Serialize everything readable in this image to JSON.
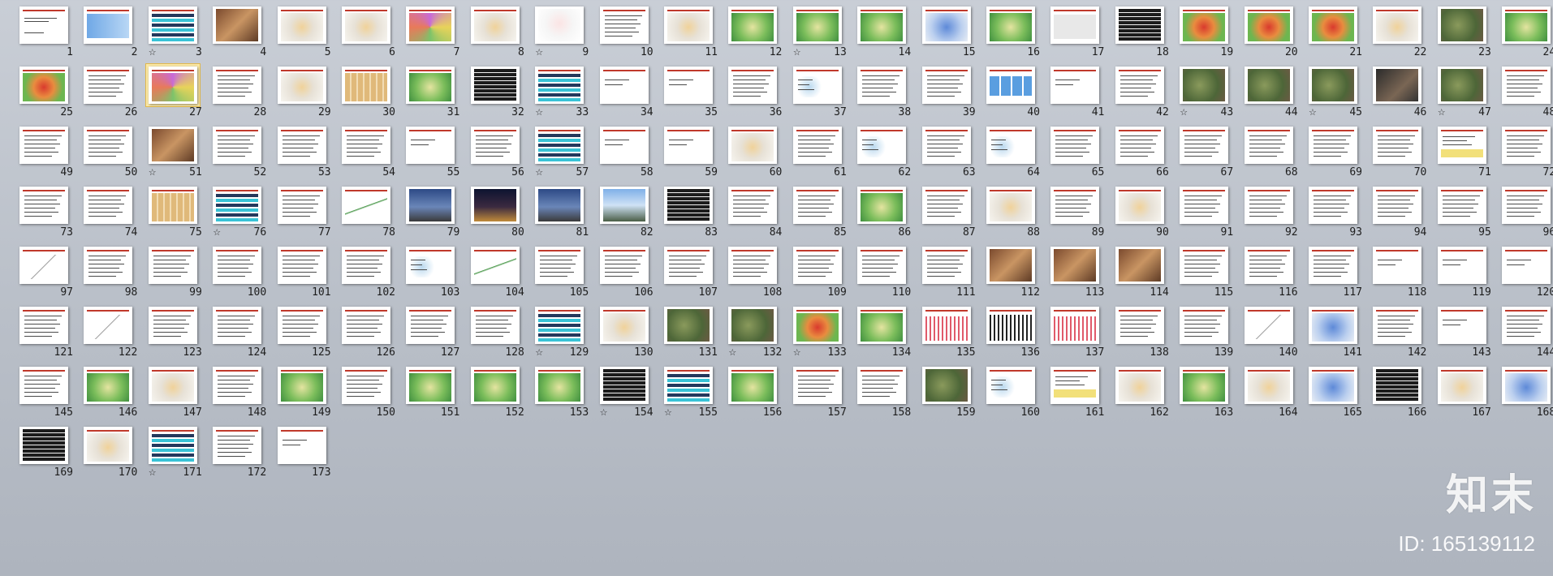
{
  "slides": [
    {
      "n": "1",
      "anim": false,
      "kind": "title"
    },
    {
      "n": "2",
      "anim": false,
      "kind": "blue"
    },
    {
      "n": "3",
      "anim": true,
      "kind": "table-cyan"
    },
    {
      "n": "4",
      "anim": false,
      "kind": "photo-brown"
    },
    {
      "n": "5",
      "anim": false,
      "kind": "map-light"
    },
    {
      "n": "6",
      "anim": false,
      "kind": "map-light"
    },
    {
      "n": "7",
      "anim": false,
      "kind": "map-color"
    },
    {
      "n": "8",
      "anim": false,
      "kind": "map-light"
    },
    {
      "n": "9",
      "anim": true,
      "kind": "cartoon"
    },
    {
      "n": "10",
      "anim": false,
      "kind": "text"
    },
    {
      "n": "11",
      "anim": false,
      "kind": "map-light"
    },
    {
      "n": "12",
      "anim": false,
      "kind": "map-green"
    },
    {
      "n": "13",
      "anim": true,
      "kind": "map-green"
    },
    {
      "n": "14",
      "anim": false,
      "kind": "map-green"
    },
    {
      "n": "15",
      "anim": false,
      "kind": "map-blue"
    },
    {
      "n": "16",
      "anim": false,
      "kind": "map-green"
    },
    {
      "n": "17",
      "anim": false,
      "kind": "text-grey"
    },
    {
      "n": "18",
      "anim": false,
      "kind": "table-dark"
    },
    {
      "n": "19",
      "anim": false,
      "kind": "map-red"
    },
    {
      "n": "20",
      "anim": false,
      "kind": "map-red"
    },
    {
      "n": "21",
      "anim": false,
      "kind": "map-red"
    },
    {
      "n": "22",
      "anim": false,
      "kind": "map-light"
    },
    {
      "n": "23",
      "anim": false,
      "kind": "photo-aerial"
    },
    {
      "n": "24",
      "anim": false,
      "kind": "map-green"
    },
    {
      "n": "25",
      "anim": false,
      "kind": "map-red"
    },
    {
      "n": "26",
      "anim": false,
      "kind": "text"
    },
    {
      "n": "27",
      "anim": false,
      "kind": "map-color",
      "selected": true
    },
    {
      "n": "28",
      "anim": false,
      "kind": "text"
    },
    {
      "n": "29",
      "anim": false,
      "kind": "map-light"
    },
    {
      "n": "30",
      "anim": false,
      "kind": "map-tan"
    },
    {
      "n": "31",
      "anim": false,
      "kind": "map-green"
    },
    {
      "n": "32",
      "anim": false,
      "kind": "table-dark"
    },
    {
      "n": "33",
      "anim": true,
      "kind": "table-cyan"
    },
    {
      "n": "34",
      "anim": false,
      "kind": "text-short"
    },
    {
      "n": "35",
      "anim": false,
      "kind": "text-short"
    },
    {
      "n": "36",
      "anim": false,
      "kind": "text"
    },
    {
      "n": "37",
      "anim": false,
      "kind": "diagram"
    },
    {
      "n": "38",
      "anim": false,
      "kind": "text"
    },
    {
      "n": "39",
      "anim": false,
      "kind": "text"
    },
    {
      "n": "40",
      "anim": false,
      "kind": "blue-blocks"
    },
    {
      "n": "41",
      "anim": false,
      "kind": "text-short"
    },
    {
      "n": "42",
      "anim": false,
      "kind": "text"
    },
    {
      "n": "43",
      "anim": true,
      "kind": "photo-aerial"
    },
    {
      "n": "44",
      "anim": false,
      "kind": "photo-aerial"
    },
    {
      "n": "45",
      "anim": true,
      "kind": "photo-aerial"
    },
    {
      "n": "46",
      "anim": false,
      "kind": "photo-dark"
    },
    {
      "n": "47",
      "anim": true,
      "kind": "photo-aerial"
    },
    {
      "n": "48",
      "anim": false,
      "kind": "text"
    },
    {
      "n": "49",
      "anim": false,
      "kind": "text"
    },
    {
      "n": "50",
      "anim": false,
      "kind": "text"
    },
    {
      "n": "51",
      "anim": true,
      "kind": "photo-brown"
    },
    {
      "n": "52",
      "anim": false,
      "kind": "text"
    },
    {
      "n": "53",
      "anim": false,
      "kind": "text"
    },
    {
      "n": "54",
      "anim": false,
      "kind": "text"
    },
    {
      "n": "55",
      "anim": false,
      "kind": "text-short"
    },
    {
      "n": "56",
      "anim": false,
      "kind": "text"
    },
    {
      "n": "57",
      "anim": true,
      "kind": "table-cyan"
    },
    {
      "n": "58",
      "anim": false,
      "kind": "text-short"
    },
    {
      "n": "59",
      "anim": false,
      "kind": "text-short"
    },
    {
      "n": "60",
      "anim": false,
      "kind": "map-light"
    },
    {
      "n": "61",
      "anim": false,
      "kind": "text"
    },
    {
      "n": "62",
      "anim": false,
      "kind": "diagram"
    },
    {
      "n": "63",
      "anim": false,
      "kind": "text"
    },
    {
      "n": "64",
      "anim": false,
      "kind": "diagram"
    },
    {
      "n": "65",
      "anim": false,
      "kind": "text"
    },
    {
      "n": "66",
      "anim": false,
      "kind": "text"
    },
    {
      "n": "67",
      "anim": false,
      "kind": "text"
    },
    {
      "n": "68",
      "anim": false,
      "kind": "text"
    },
    {
      "n": "69",
      "anim": false,
      "kind": "text"
    },
    {
      "n": "70",
      "anim": false,
      "kind": "text"
    },
    {
      "n": "71",
      "anim": false,
      "kind": "text-yellow"
    },
    {
      "n": "72",
      "anim": false,
      "kind": "text"
    },
    {
      "n": "73",
      "anim": false,
      "kind": "text"
    },
    {
      "n": "74",
      "anim": false,
      "kind": "text"
    },
    {
      "n": "75",
      "anim": false,
      "kind": "map-tan"
    },
    {
      "n": "76",
      "anim": true,
      "kind": "table-cyan"
    },
    {
      "n": "77",
      "anim": false,
      "kind": "text"
    },
    {
      "n": "78",
      "anim": false,
      "kind": "chart"
    },
    {
      "n": "79",
      "anim": false,
      "kind": "photo-city"
    },
    {
      "n": "80",
      "anim": false,
      "kind": "photo-night"
    },
    {
      "n": "81",
      "anim": false,
      "kind": "photo-city"
    },
    {
      "n": "82",
      "anim": false,
      "kind": "photo-sky"
    },
    {
      "n": "83",
      "anim": false,
      "kind": "table-dark"
    },
    {
      "n": "84",
      "anim": false,
      "kind": "text"
    },
    {
      "n": "85",
      "anim": false,
      "kind": "text"
    },
    {
      "n": "86",
      "anim": false,
      "kind": "map-green"
    },
    {
      "n": "87",
      "anim": false,
      "kind": "text"
    },
    {
      "n": "88",
      "anim": false,
      "kind": "map-light"
    },
    {
      "n": "89",
      "anim": false,
      "kind": "text"
    },
    {
      "n": "90",
      "anim": false,
      "kind": "map-light"
    },
    {
      "n": "91",
      "anim": false,
      "kind": "text"
    },
    {
      "n": "92",
      "anim": false,
      "kind": "text"
    },
    {
      "n": "93",
      "anim": false,
      "kind": "text"
    },
    {
      "n": "94",
      "anim": false,
      "kind": "text"
    },
    {
      "n": "95",
      "anim": false,
      "kind": "text"
    },
    {
      "n": "96",
      "anim": false,
      "kind": "text"
    },
    {
      "n": "97",
      "anim": false,
      "kind": "triangle"
    },
    {
      "n": "98",
      "anim": false,
      "kind": "text"
    },
    {
      "n": "99",
      "anim": false,
      "kind": "text"
    },
    {
      "n": "100",
      "anim": false,
      "kind": "text"
    },
    {
      "n": "101",
      "anim": false,
      "kind": "text"
    },
    {
      "n": "102",
      "anim": false,
      "kind": "text"
    },
    {
      "n": "103",
      "anim": false,
      "kind": "diagram"
    },
    {
      "n": "104",
      "anim": false,
      "kind": "chart"
    },
    {
      "n": "105",
      "anim": false,
      "kind": "text"
    },
    {
      "n": "106",
      "anim": false,
      "kind": "text"
    },
    {
      "n": "107",
      "anim": false,
      "kind": "text"
    },
    {
      "n": "108",
      "anim": false,
      "kind": "text"
    },
    {
      "n": "109",
      "anim": false,
      "kind": "text"
    },
    {
      "n": "110",
      "anim": false,
      "kind": "text"
    },
    {
      "n": "111",
      "anim": false,
      "kind": "text"
    },
    {
      "n": "112",
      "anim": false,
      "kind": "photo-brown"
    },
    {
      "n": "113",
      "anim": false,
      "kind": "photo-brown"
    },
    {
      "n": "114",
      "anim": false,
      "kind": "photo-brown"
    },
    {
      "n": "115",
      "anim": false,
      "kind": "text"
    },
    {
      "n": "116",
      "anim": false,
      "kind": "text"
    },
    {
      "n": "117",
      "anim": false,
      "kind": "text"
    },
    {
      "n": "118",
      "anim": false,
      "kind": "text-short"
    },
    {
      "n": "119",
      "anim": false,
      "kind": "text-short"
    },
    {
      "n": "120",
      "anim": false,
      "kind": "text-short"
    },
    {
      "n": "121",
      "anim": false,
      "kind": "text"
    },
    {
      "n": "122",
      "anim": false,
      "kind": "triangle"
    },
    {
      "n": "123",
      "anim": false,
      "kind": "text"
    },
    {
      "n": "124",
      "anim": false,
      "kind": "text"
    },
    {
      "n": "125",
      "anim": false,
      "kind": "text"
    },
    {
      "n": "126",
      "anim": false,
      "kind": "text"
    },
    {
      "n": "127",
      "anim": false,
      "kind": "text"
    },
    {
      "n": "128",
      "anim": false,
      "kind": "text"
    },
    {
      "n": "129",
      "anim": true,
      "kind": "table-cyan"
    },
    {
      "n": "130",
      "anim": false,
      "kind": "map-light"
    },
    {
      "n": "131",
      "anim": false,
      "kind": "photo-aerial"
    },
    {
      "n": "132",
      "anim": true,
      "kind": "photo-aerial"
    },
    {
      "n": "133",
      "anim": true,
      "kind": "map-red"
    },
    {
      "n": "134",
      "anim": false,
      "kind": "map-green"
    },
    {
      "n": "135",
      "anim": false,
      "kind": "chart-bars"
    },
    {
      "n": "136",
      "anim": false,
      "kind": "chart-dark"
    },
    {
      "n": "137",
      "anim": false,
      "kind": "chart-bars"
    },
    {
      "n": "138",
      "anim": false,
      "kind": "text"
    },
    {
      "n": "139",
      "anim": false,
      "kind": "text"
    },
    {
      "n": "140",
      "anim": false,
      "kind": "triangle"
    },
    {
      "n": "141",
      "anim": false,
      "kind": "map-blue"
    },
    {
      "n": "142",
      "anim": false,
      "kind": "text"
    },
    {
      "n": "143",
      "anim": false,
      "kind": "text-short"
    },
    {
      "n": "144",
      "anim": false,
      "kind": "text"
    },
    {
      "n": "145",
      "anim": false,
      "kind": "text"
    },
    {
      "n": "146",
      "anim": false,
      "kind": "map-green"
    },
    {
      "n": "147",
      "anim": false,
      "kind": "map-light"
    },
    {
      "n": "148",
      "anim": false,
      "kind": "text"
    },
    {
      "n": "149",
      "anim": false,
      "kind": "map-green"
    },
    {
      "n": "150",
      "anim": false,
      "kind": "text"
    },
    {
      "n": "151",
      "anim": false,
      "kind": "map-green"
    },
    {
      "n": "152",
      "anim": false,
      "kind": "map-green"
    },
    {
      "n": "153",
      "anim": false,
      "kind": "map-green"
    },
    {
      "n": "154",
      "anim": true,
      "kind": "table-dark"
    },
    {
      "n": "155",
      "anim": true,
      "kind": "table-cyan"
    },
    {
      "n": "156",
      "anim": false,
      "kind": "map-green"
    },
    {
      "n": "157",
      "anim": false,
      "kind": "text"
    },
    {
      "n": "158",
      "anim": false,
      "kind": "text"
    },
    {
      "n": "159",
      "anim": false,
      "kind": "photo-aerial"
    },
    {
      "n": "160",
      "anim": false,
      "kind": "diagram"
    },
    {
      "n": "161",
      "anim": false,
      "kind": "text-yellow"
    },
    {
      "n": "162",
      "anim": false,
      "kind": "map-light"
    },
    {
      "n": "163",
      "anim": false,
      "kind": "map-green"
    },
    {
      "n": "164",
      "anim": false,
      "kind": "map-light"
    },
    {
      "n": "165",
      "anim": false,
      "kind": "map-blue"
    },
    {
      "n": "166",
      "anim": false,
      "kind": "table-dark"
    },
    {
      "n": "167",
      "anim": false,
      "kind": "map-light"
    },
    {
      "n": "168",
      "anim": false,
      "kind": "map-blue"
    },
    {
      "n": "169",
      "anim": false,
      "kind": "table-dark"
    },
    {
      "n": "170",
      "anim": false,
      "kind": "map-light"
    },
    {
      "n": "171",
      "anim": true,
      "kind": "table-cyan"
    },
    {
      "n": "172",
      "anim": false,
      "kind": "text"
    },
    {
      "n": "173",
      "anim": false,
      "kind": "text-short"
    }
  ],
  "animation_glyph": "☆",
  "watermark": {
    "logo_text": "知末",
    "id_text": "ID: 165139112"
  },
  "colors": {
    "background": "#bcc2cb",
    "selection": "#fbe9a8",
    "accent_red": "#c0392b"
  }
}
